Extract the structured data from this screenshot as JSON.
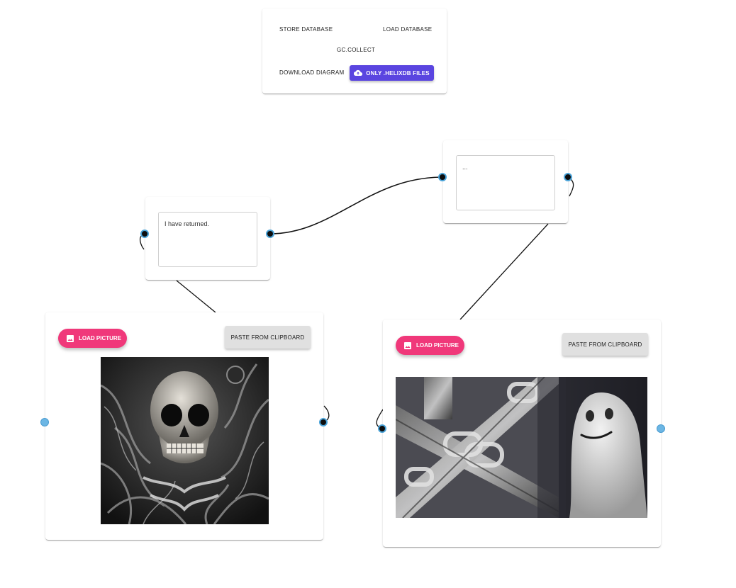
{
  "toolbar": {
    "store_label": "STORE DATABASE",
    "load_label": "LOAD DATABASE",
    "gc_label": "GC.COLLECT",
    "download_label": "DOWNLOAD DIAGRAM",
    "upload_label": "ONLY .HELIXDB FILES"
  },
  "text_nodes": [
    {
      "text": "I have returned."
    },
    {
      "text": "..."
    }
  ],
  "image_nodes": [
    {
      "load_label": "LOAD PICTURE",
      "paste_label": "PASTE FROM CLIPBOARD",
      "image_icon": "image-icon",
      "picture": "skull-picture"
    },
    {
      "load_label": "LOAD PICTURE",
      "paste_label": "PASTE FROM CLIPBOARD",
      "image_icon": "image-icon",
      "picture": "ghost-machinery-picture"
    }
  ],
  "colors": {
    "upload_button": "#5a45e0",
    "load_picture_button": "#f0387a",
    "port_border": "#4aa3d8",
    "port_light": "#6cb6e4"
  },
  "icons": {
    "upload": "cloud-upload-icon",
    "load_picture": "image-icon"
  }
}
